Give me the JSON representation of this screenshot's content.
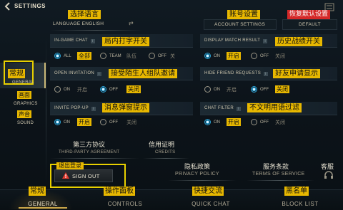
{
  "header": {
    "title": "SETTINGS",
    "language_label": "LANGUAGE ENGLISH",
    "account_settings": "ACCOUNT SETTINGS",
    "default_label": "DEFAULT",
    "tag_language": "选择语言",
    "tag_account": "账号设置",
    "tag_default": "恢复默认设置"
  },
  "sidebar": {
    "general_cn": "常规",
    "general": "GENERAL",
    "graphics_cn": "画面",
    "graphics": "GRAPHICS",
    "sound_cn": "声音",
    "sound": "SOUND"
  },
  "options": {
    "ingame_chat": {
      "label": "IN-GAME CHAT",
      "tag": "局内打字开关",
      "all": "ALL",
      "all_cn": "全部",
      "team": "TEAM",
      "team_cn": "队伍",
      "off": "OFF",
      "off_cn": "关"
    },
    "display_match": {
      "label": "DISPLAY MATCH RESULT",
      "tag": "历史战绩开关",
      "on": "ON",
      "on_cn": "开启",
      "off": "OFF",
      "off_cn": "关闭"
    },
    "open_invitation": {
      "label": "OPEN INVITATION",
      "tag": "接受陌生人组队邀请",
      "on": "ON",
      "on_cn": "开启",
      "off": "OFF",
      "off_cn": "关闭"
    },
    "hide_friend": {
      "label": "HIDE FRIEND REQUESTS",
      "tag": "好友申请显示",
      "on": "ON",
      "on_cn": "开启",
      "off": "OFF",
      "off_cn": "关闭"
    },
    "invite_popup": {
      "label": "INVITE POP-UP",
      "tag": "消息弹窗提示",
      "on": "ON",
      "on_cn": "开启",
      "off": "OFF",
      "off_cn": "关闭"
    },
    "chat_filter": {
      "label": "CHAT FILTER",
      "tag": "不文明用语过滤",
      "on": "ON",
      "on_cn": "开启",
      "off": "OFF",
      "off_cn": "关闭"
    }
  },
  "links": {
    "third_party_cn": "第三方协议",
    "third_party": "THIRD-PARTY AGREEMENT",
    "credits_cn": "信用证明",
    "credits": "CREDITS",
    "privacy_cn": "隐私政策",
    "privacy": "PRIVACY POLICY",
    "terms_cn": "服务条款",
    "terms": "TERMS OF SERVICE",
    "support_cn": "客服",
    "sign_out_cn": "退出登录",
    "sign_out": "SIGN OUT"
  },
  "tabs": {
    "general_cn": "常规",
    "general": "GENERAL",
    "controls_cn": "操作面板",
    "controls": "CONTROLS",
    "quickchat_cn": "快捷交流",
    "quickchat": "QUICK CHAT",
    "blocklist_cn": "黑名单",
    "blocklist": "BLOCK LIST"
  }
}
